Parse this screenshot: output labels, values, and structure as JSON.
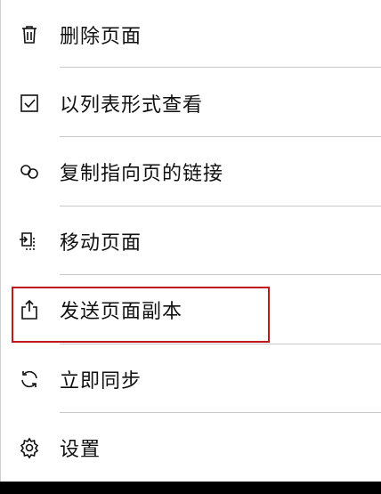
{
  "menu": {
    "items": [
      {
        "label": "删除页面",
        "icon": "trash-icon"
      },
      {
        "label": "以列表形式查看",
        "icon": "checkbox-icon"
      },
      {
        "label": "复制指向页的链接",
        "icon": "link-icon"
      },
      {
        "label": "移动页面",
        "icon": "move-page-icon"
      },
      {
        "label": "发送页面副本",
        "icon": "share-icon"
      },
      {
        "label": "立即同步",
        "icon": "sync-icon"
      },
      {
        "label": "设置",
        "icon": "gear-icon"
      }
    ]
  },
  "colors": {
    "highlight": "#c0171d",
    "text": "#111111",
    "divider": "#c8c8c8"
  }
}
